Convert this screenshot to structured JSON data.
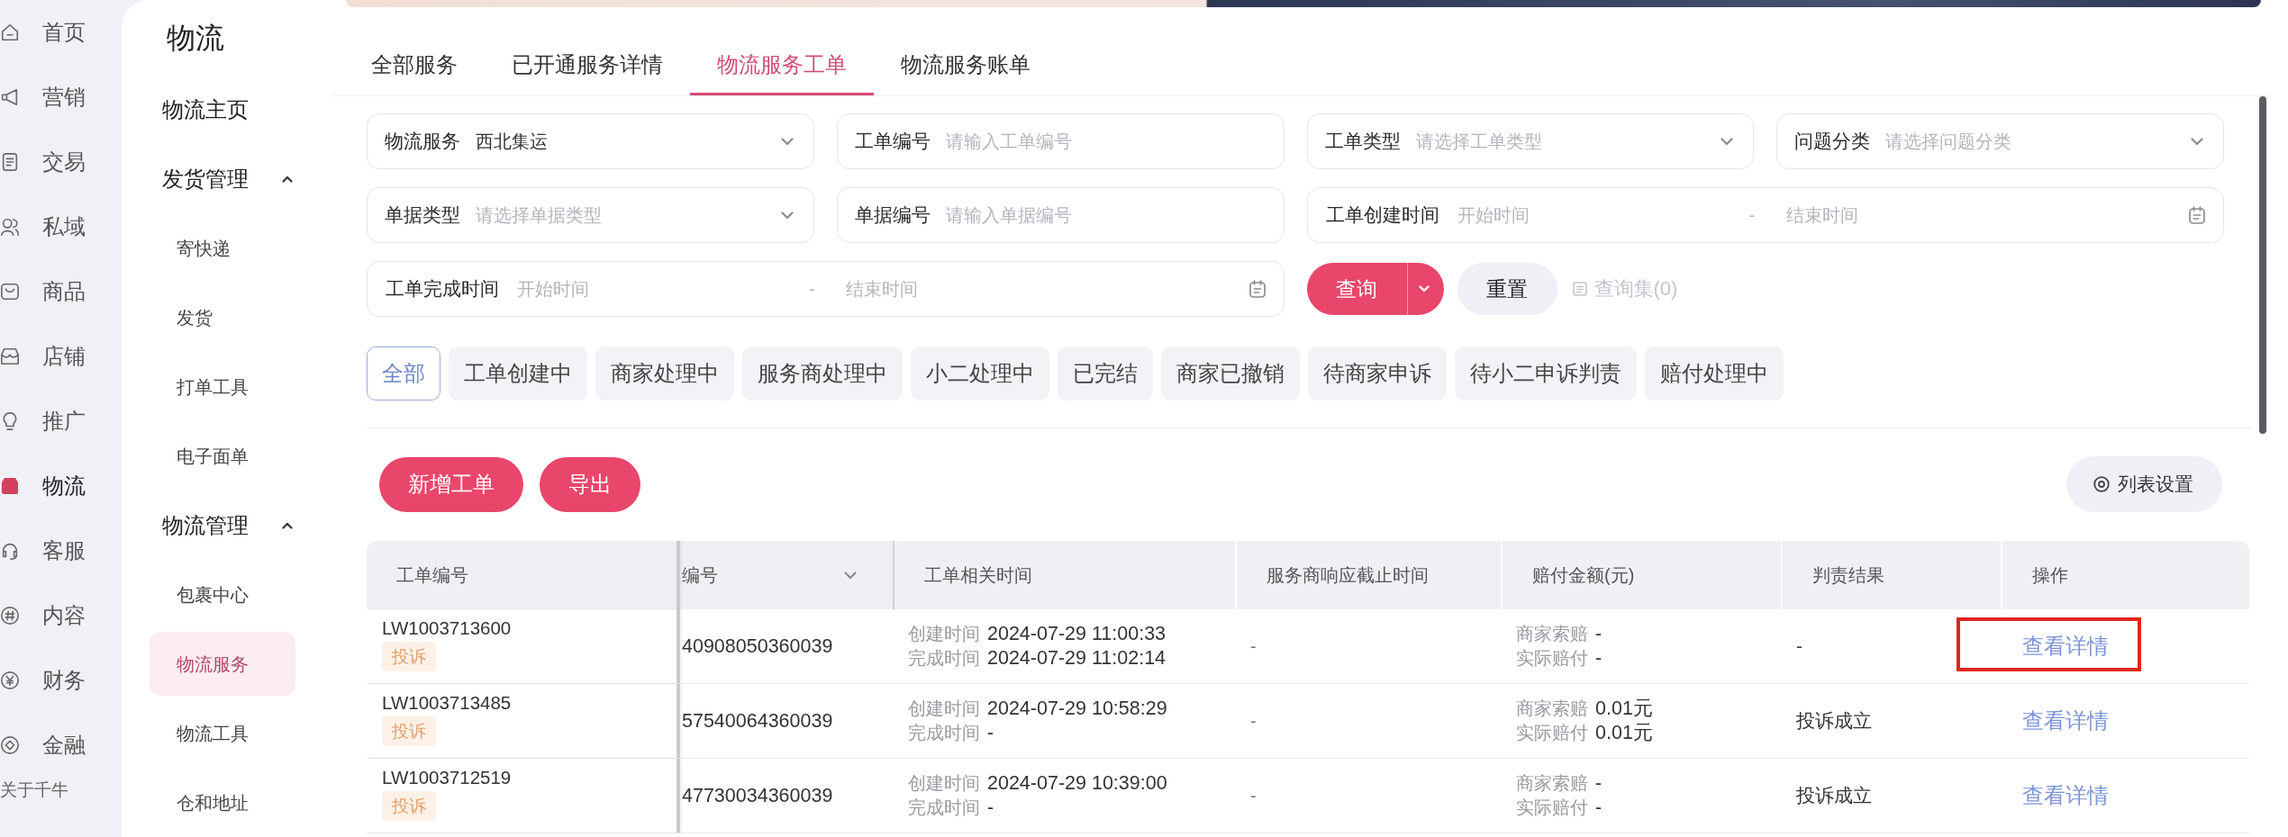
{
  "nav": {
    "items": [
      {
        "label": "首页",
        "selected": false
      },
      {
        "label": "营销",
        "selected": false
      },
      {
        "label": "交易",
        "selected": false
      },
      {
        "label": "私域",
        "selected": false
      },
      {
        "label": "商品",
        "selected": false
      },
      {
        "label": "店铺",
        "selected": false
      },
      {
        "label": "推广",
        "selected": false
      },
      {
        "label": "物流",
        "selected": true
      },
      {
        "label": "客服",
        "selected": false
      },
      {
        "label": "内容",
        "selected": false
      },
      {
        "label": "财务",
        "selected": false
      },
      {
        "label": "金融",
        "selected": false
      }
    ],
    "footer": "关于千牛"
  },
  "sidebar": {
    "title": "物流",
    "items": [
      {
        "label": "物流主页",
        "selected": false
      },
      {
        "label": "发货管理",
        "expanded": true,
        "children": [
          {
            "label": "寄快递",
            "selected": false
          },
          {
            "label": "发货",
            "selected": false
          },
          {
            "label": "打单工具",
            "selected": false
          },
          {
            "label": "电子面单",
            "selected": false
          }
        ]
      },
      {
        "label": "物流管理",
        "expanded": true,
        "children": [
          {
            "label": "包裹中心",
            "selected": false
          },
          {
            "label": "物流服务",
            "selected": true
          },
          {
            "label": "物流工具",
            "selected": false
          },
          {
            "label": "仓和地址",
            "selected": false
          }
        ]
      }
    ]
  },
  "tabs": [
    {
      "label": "全部服务",
      "selected": false
    },
    {
      "label": "已开通服务详情",
      "selected": false
    },
    {
      "label": "物流服务工单",
      "selected": true
    },
    {
      "label": "物流服务账单",
      "selected": false
    }
  ],
  "filter_form": {
    "fields": [
      {
        "kind": "select",
        "label": "物流服务",
        "value": "西北集运"
      },
      {
        "kind": "text",
        "label": "工单编号",
        "placeholder": "请输入工单编号"
      },
      {
        "kind": "select",
        "label": "工单类型",
        "placeholder": "请选择工单类型"
      },
      {
        "kind": "select",
        "label": "问题分类",
        "placeholder": "请选择问题分类"
      },
      {
        "kind": "select",
        "label": "单据类型",
        "placeholder": "请选择单据类型"
      },
      {
        "kind": "text",
        "label": "单据编号",
        "placeholder": "请输入单据编号"
      },
      {
        "kind": "date_range",
        "label": "工单创建时间",
        "start_placeholder": "开始时间",
        "separator": "-",
        "end_placeholder": "结束时间"
      },
      {
        "kind": "date_range",
        "label": "工单完成时间",
        "start_placeholder": "开始时间",
        "separator": "-",
        "end_placeholder": "结束时间"
      }
    ],
    "search": "查询",
    "reset": "重置",
    "saved_queries": {
      "label": "查询集(0)",
      "disabled": true
    }
  },
  "status_filters": [
    {
      "label": "全部",
      "selected": true
    },
    {
      "label": "工单创建中",
      "selected": false
    },
    {
      "label": "商家处理中",
      "selected": false
    },
    {
      "label": "服务商处理中",
      "selected": false
    },
    {
      "label": "小二处理中",
      "selected": false
    },
    {
      "label": "已完结",
      "selected": false
    },
    {
      "label": "商家已撤销",
      "selected": false
    },
    {
      "label": "待商家申诉",
      "selected": false
    },
    {
      "label": "待小二申诉判责",
      "selected": false
    },
    {
      "label": "赔付处理中",
      "selected": false
    }
  ],
  "toolbar": {
    "buttons": [
      "新增工单",
      "导出"
    ],
    "column_settings": "列表设置"
  },
  "table": {
    "columns": [
      {
        "label": "工单编号",
        "dropdown": false
      },
      {
        "label": "编号",
        "dropdown": true
      },
      {
        "label": "工单相关时间",
        "dropdown": false
      },
      {
        "label": "服务商响应截止时间",
        "dropdown": false
      },
      {
        "label": "赔付金额(元)",
        "dropdown": false
      },
      {
        "label": "判责结果",
        "dropdown": false
      },
      {
        "label": "操作",
        "dropdown": false
      }
    ],
    "rows": [
      {
        "ticket_no": "LW1003713600",
        "tag": "投诉",
        "document_no": "40908050360039",
        "created_label": "创建时间",
        "created": "2024-07-29 11:00:33",
        "completed_label": "完成时间",
        "completed": "2024-07-29 11:02:14",
        "response_deadline": "-",
        "claim_label": "商家索赔",
        "claim": "-",
        "paid_label": "实际赔付",
        "paid": "-",
        "verdict": "-",
        "action": "查看详情",
        "highlighted": true
      },
      {
        "ticket_no": "LW1003713485",
        "tag": "投诉",
        "document_no": "57540064360039",
        "created_label": "创建时间",
        "created": "2024-07-29 10:58:29",
        "completed_label": "完成时间",
        "completed": "-",
        "response_deadline": "-",
        "claim_label": "商家索赔",
        "claim": "0.01元",
        "paid_label": "实际赔付",
        "paid": "0.01元",
        "verdict": "投诉成立",
        "action": "查看详情",
        "highlighted": false
      },
      {
        "ticket_no": "LW1003712519",
        "tag": "投诉",
        "document_no": "47730034360039",
        "created_label": "创建时间",
        "created": "2024-07-29 10:39:00",
        "completed_label": "完成时间",
        "completed": "-",
        "response_deadline": "-",
        "claim_label": "商家索赔",
        "claim": "-",
        "paid_label": "实际赔付",
        "paid": "-",
        "verdict": "投诉成立",
        "action": "查看详情",
        "highlighted": false
      }
    ]
  }
}
